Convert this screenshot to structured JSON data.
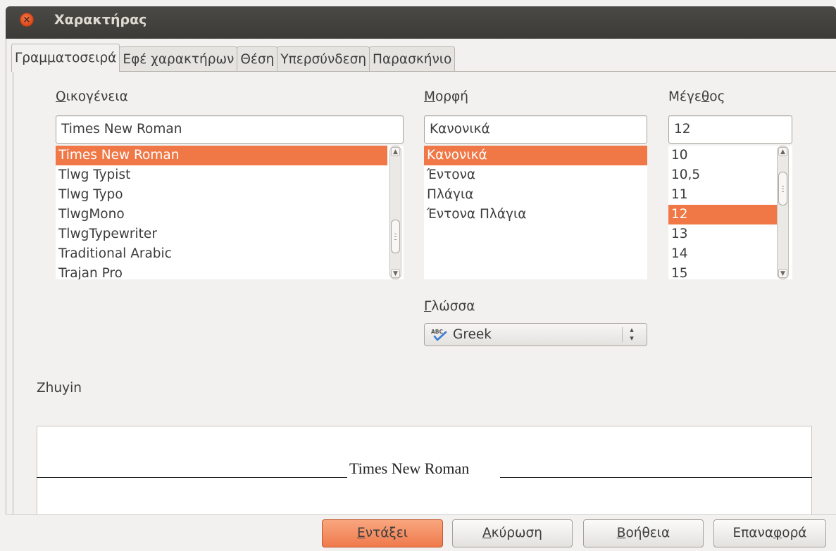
{
  "window": {
    "title": "Χαρακτήρας"
  },
  "tabs": [
    {
      "label": "Γραμματοσειρά",
      "active": true
    },
    {
      "label": "Εφέ χαρακτήρων",
      "active": false
    },
    {
      "label": "Θέση",
      "active": false
    },
    {
      "label": "Υπερσύνδεση",
      "active": false
    },
    {
      "label": "Παρασκήνιο",
      "active": false
    }
  ],
  "family": {
    "label_first": "Ο",
    "label_rest": "ικογένεια",
    "value": "Times New Roman",
    "items": [
      "Times New Roman",
      "Tlwg Typist",
      "Tlwg Typo",
      "TlwgMono",
      "TlwgTypewriter",
      "Traditional Arabic",
      "Trajan Pro"
    ],
    "selected_index": 0
  },
  "style": {
    "label_first": "Μ",
    "label_rest": "ορφή",
    "value": "Κανονικά",
    "items": [
      "Κανονικά",
      "Έντονα",
      "Πλάγια",
      "Έντονα Πλάγια"
    ],
    "selected_index": 0
  },
  "size": {
    "label_before": "Μέγε",
    "label_u": "θ",
    "label_after": "ος",
    "value": "12",
    "items": [
      "10",
      "10,5",
      "11",
      "12",
      "13",
      "14",
      "15"
    ],
    "selected_index": 3
  },
  "language": {
    "label_first": "Γ",
    "label_rest": "λώσσα",
    "value": "Greek",
    "icon": "spellcheck-abc-icon"
  },
  "zhuyin": {
    "label": "Zhuyin"
  },
  "preview": {
    "text": "Times New Roman"
  },
  "buttons": {
    "ok_first": "Ε",
    "ok_rest": "ντάξει",
    "cancel_first": "Α",
    "cancel_rest": "κύρωση",
    "help_first": "Β",
    "help_rest": "οήθεια",
    "reset_before": "Επανα",
    "reset_u": "φ",
    "reset_after": "ορά"
  },
  "colors": {
    "accent": "#f07746",
    "titlebar": "#3c3b37",
    "close_button": "#dd4814"
  }
}
